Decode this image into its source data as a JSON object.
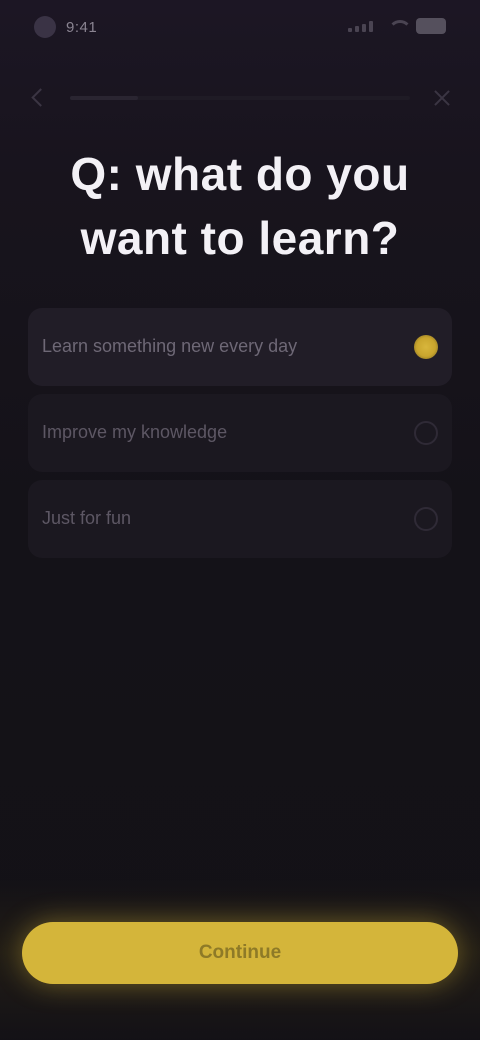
{
  "status_bar": {
    "time": "9:41",
    "battery_icon": "battery-icon",
    "wifi_icon": "wifi-icon",
    "signal_icon": "signal-icon"
  },
  "nav": {
    "back_icon": "back-icon",
    "close_icon": "close-icon",
    "progress": 0.2
  },
  "headline": "Q: what do you want to learn?",
  "options": [
    {
      "label": "Learn something new every day",
      "selected": true
    },
    {
      "label": "Improve my knowledge",
      "selected": false
    },
    {
      "label": "Just for fun",
      "selected": false
    }
  ],
  "continue_button": {
    "label": "Continue"
  },
  "colors": {
    "accent": "#d4b53a",
    "background": "#141218",
    "option_background": "#1b1820"
  }
}
